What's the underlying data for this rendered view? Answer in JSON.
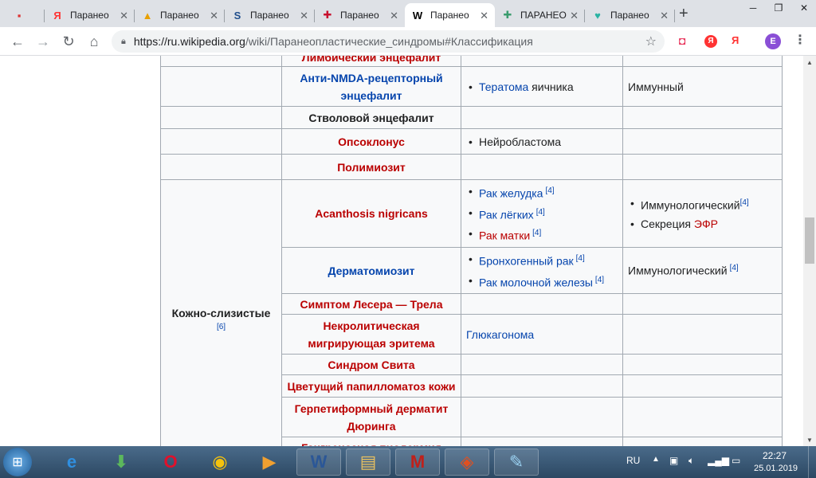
{
  "browser": {
    "tabs": [
      {
        "title": "",
        "icon": "dark-app-icon",
        "glyph": "▪",
        "color": "#d33"
      },
      {
        "title": "Паранео",
        "icon": "yandex-icon",
        "glyph": "Я",
        "color": "#f33"
      },
      {
        "title": "Паранео",
        "icon": "mountain-icon",
        "glyph": "▲",
        "color": "#e8a000"
      },
      {
        "title": "Паранео",
        "icon": "s-logo-icon",
        "glyph": "S",
        "color": "#1f4e8c"
      },
      {
        "title": "Паранео",
        "icon": "red-cross-icon",
        "glyph": "✚",
        "color": "#c8102e"
      },
      {
        "title": "Паранео",
        "icon": "wikipedia-icon",
        "glyph": "W",
        "color": "#000"
      },
      {
        "title": "ПАРАНЕО",
        "icon": "medical-globe-icon",
        "glyph": "✚",
        "color": "#3a9c6e"
      },
      {
        "title": "Паранео",
        "icon": "heart-icon",
        "glyph": "♥",
        "color": "#2bb3a3"
      }
    ],
    "new_tab": "+",
    "url_host": "https://ru.wikipedia.org",
    "url_path": "/wiki/Паранеопластические_синдромы#Классификация",
    "ext_yandex": "Я",
    "ext_ya2": "Я",
    "profile": "E"
  },
  "table": {
    "top_row_partial": "Лимбический энцефалит",
    "rows_a": [
      {
        "name": "Анти-NMDA-рецепторный энцефалит",
        "color": "blue",
        "tumors": [
          {
            "text": "Тератома",
            "tail": " яичника",
            "color": "blue"
          }
        ],
        "mech": "Иммунный"
      },
      {
        "name": "Стволовой энцефалит",
        "color": "dark",
        "tumors": [],
        "mech": ""
      },
      {
        "name": "Опсоклонус",
        "color": "red",
        "tumors": [
          {
            "text": "Нейробластома",
            "tail": "",
            "color": "dark"
          }
        ],
        "mech": ""
      },
      {
        "name": "Полимиозит",
        "color": "red",
        "tumors": [],
        "mech": ""
      }
    ],
    "group_label": "Кожно-слизистые",
    "group_ref": "[6]",
    "acanthosis": {
      "name": "Acanthosis nigricans",
      "tumors": [
        {
          "text": "Рак желудка",
          "ref": "[4]",
          "color": "blue"
        },
        {
          "text": "Рак лёгких",
          "ref": "[4]",
          "color": "blue"
        },
        {
          "text": "Рак матки",
          "ref": "[4]",
          "color": "red"
        }
      ],
      "mech": [
        {
          "text": "Иммунологический",
          "ref": "[4]",
          "link": ""
        },
        {
          "text": "Секреция ",
          "ref": "",
          "link": "ЭФР"
        }
      ]
    },
    "dermatomyositis": {
      "name": "Дерматомиозит",
      "tumors": [
        {
          "text": "Бронхогенный рак",
          "ref": "[4]"
        },
        {
          "text": "Рак молочной железы",
          "ref": "[4]"
        }
      ],
      "mech": "Иммунологический",
      "mech_ref": "[4]"
    },
    "leser": "Симптом Лесера — Трела",
    "necrolytic": {
      "name": "Некролитическая мигрирующая эритема",
      "tumor": "Глюкагонома"
    },
    "sweet": "Синдром Свита",
    "papillomatosis": "Цветущий папилломатоз кожи",
    "duhring": "Герпетиформный дерматит Дюринга",
    "gangrenous": "Гангренозная пиодермия"
  },
  "taskbar": {
    "lang": "RU",
    "time": "22:27",
    "date": "25.01.2019",
    "apps": [
      {
        "name": "ie-icon",
        "glyph": "e",
        "color": "#2f8fe0"
      },
      {
        "name": "download-manager-icon",
        "glyph": "⬇",
        "color": "#5cb85c"
      },
      {
        "name": "opera-icon",
        "glyph": "O",
        "color": "#e0112b"
      },
      {
        "name": "chrome-icon",
        "glyph": "◉",
        "color": "#f4c20d"
      },
      {
        "name": "media-player-icon",
        "glyph": "▶",
        "color": "#f0a030"
      },
      {
        "name": "word-icon",
        "glyph": "W",
        "color": "#2b5797"
      },
      {
        "name": "explorer-icon",
        "glyph": "▤",
        "color": "#e8c060"
      },
      {
        "name": "pdf-master-icon",
        "glyph": "M",
        "color": "#c0201a"
      },
      {
        "name": "office-tool-icon",
        "glyph": "◈",
        "color": "#e05020"
      },
      {
        "name": "notepad-icon",
        "glyph": "✎",
        "color": "#9ad0f0"
      }
    ]
  }
}
